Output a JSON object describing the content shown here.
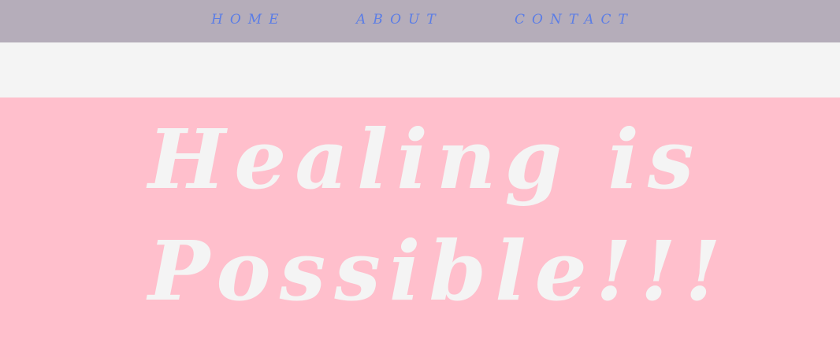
{
  "nav": {
    "items": [
      {
        "label": "HOME"
      },
      {
        "label": "ABOUT"
      },
      {
        "label": "CONTACT"
      }
    ]
  },
  "hero": {
    "line1": "Healing is",
    "line2": "Possible!!!"
  },
  "colors": {
    "nav_background": "#b5adba",
    "nav_link": "#5b7de6",
    "page_background": "#f4f4f4",
    "hero_background": "#ffbfcc",
    "hero_text": "#f4f4f4"
  }
}
